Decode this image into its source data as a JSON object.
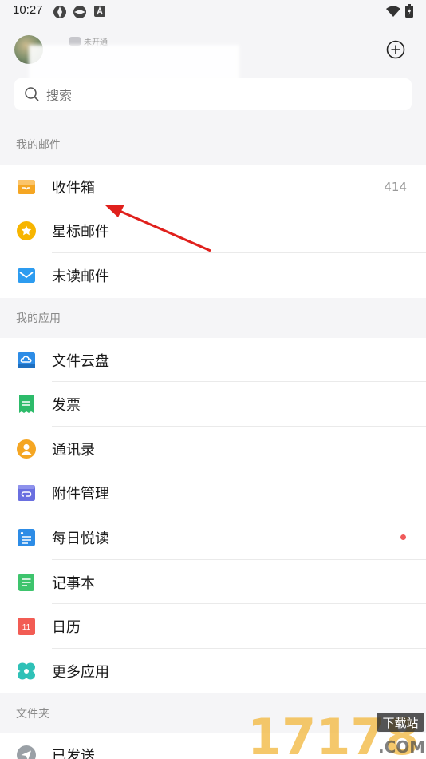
{
  "status_bar": {
    "time": "10:27"
  },
  "header": {
    "vip_label": "未开通",
    "search_placeholder": "搜索"
  },
  "sections": [
    {
      "title": "我的邮件",
      "items": [
        {
          "label": "收件箱",
          "count": "414",
          "icon": "inbox-icon",
          "color": "#f5a623"
        },
        {
          "label": "星标邮件",
          "icon": "star-icon",
          "color": "#f7b500"
        },
        {
          "label": "未读邮件",
          "icon": "envelope-icon",
          "color": "#2d9cf0"
        }
      ]
    },
    {
      "title": "我的应用",
      "items": [
        {
          "label": "文件云盘",
          "icon": "cloud-drive-icon",
          "color": "#2d8ce6"
        },
        {
          "label": "发票",
          "icon": "invoice-icon",
          "color": "#2dbb6a"
        },
        {
          "label": "通讯录",
          "icon": "contacts-icon",
          "color": "#f5a623"
        },
        {
          "label": "附件管理",
          "icon": "attachment-icon",
          "color": "#6a6fe0"
        },
        {
          "label": "每日悦读",
          "icon": "daily-reading-icon",
          "color": "#2d8ce6",
          "badge_dot": true
        },
        {
          "label": "记事本",
          "icon": "notepad-icon",
          "color": "#3ec46d"
        },
        {
          "label": "日历",
          "icon": "calendar-icon",
          "color": "#f25c54",
          "calendar_day": "11"
        },
        {
          "label": "更多应用",
          "icon": "more-apps-icon",
          "color": "#2fc1b7"
        }
      ]
    },
    {
      "title": "文件夹",
      "items": [
        {
          "label": "已发送",
          "icon": "sent-icon",
          "color": "#9aa0a6"
        }
      ]
    }
  ],
  "watermark": {
    "text": "17178",
    "badge": "下载站",
    "suffix": ".COM"
  }
}
